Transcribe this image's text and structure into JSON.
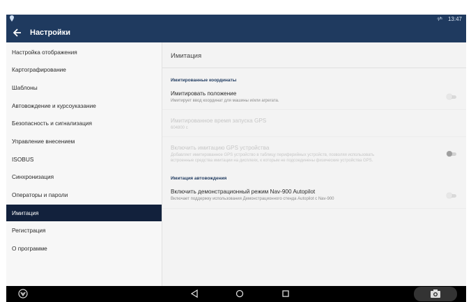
{
  "status_bar": {
    "left_icon": "location-pin-icon",
    "indicators": "⁴⁄ʰ",
    "time": "13:47"
  },
  "app_bar": {
    "title": "Настройки",
    "back_icon": "arrow-left-icon"
  },
  "sidebar": {
    "items": [
      {
        "label": "Настройка отображения"
      },
      {
        "label": "Картографирование"
      },
      {
        "label": "Шаблоны"
      },
      {
        "label": "Автовождение и курсоуказание"
      },
      {
        "label": "Безопасность и сигнализация"
      },
      {
        "label": "Управление внесением"
      },
      {
        "label": "ISOBUS"
      },
      {
        "label": "Синхронизация"
      },
      {
        "label": "Операторы и пароли"
      },
      {
        "label": "Имитация"
      },
      {
        "label": "Регистрация"
      },
      {
        "label": "О программе"
      }
    ],
    "active_index": 9
  },
  "content": {
    "title": "Имитация",
    "sections": {
      "coords": "Имитированные координаты",
      "autopilot": "Имитация автовождения"
    },
    "settings": {
      "simulate_position": {
        "title": "Имитировать положение",
        "subtitle": "Имитирует ввод координат для машины и/или агрегата.",
        "enabled": false
      },
      "gps_start_time": {
        "title": "Имитированное время запуска GPS",
        "value": "604800 с"
      },
      "gps_device": {
        "title": "Включить имитацию GPS устройства",
        "subtitle_line1": "Добавляет имитированное GPS устройство в таблицу периферийных устройств, позволяя использовать",
        "subtitle_line2": "встроенные средства имитации на дисплеях, к которым не подсоединены физические устройства GPS.",
        "enabled": false
      },
      "demo_mode": {
        "title": "Включить демонстрационный режим Nav-900 Autopilot",
        "subtitle": "Включает поддержку использования Демонстрационного стенда Autopilot с Nav-900",
        "enabled": false
      }
    }
  },
  "nav_bar": {
    "icons": [
      "logo-icon",
      "back-triangle-icon",
      "home-circle-icon",
      "recents-square-icon",
      "screenshot-icon"
    ]
  }
}
